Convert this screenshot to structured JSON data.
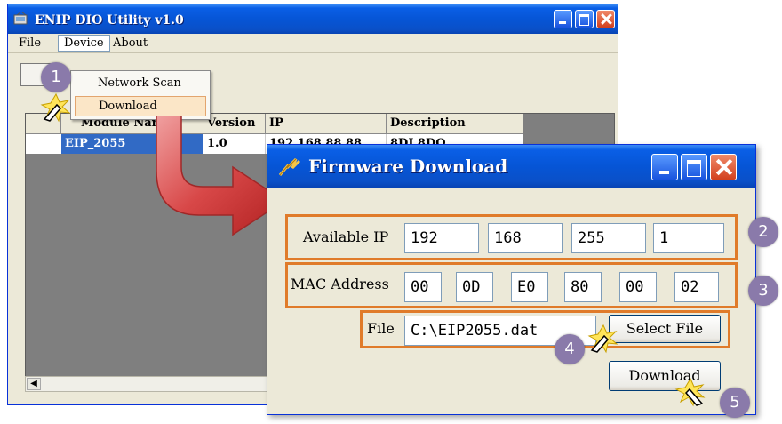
{
  "main_window": {
    "title": "ENIP DIO Utility  v1.0",
    "menu": {
      "file": "File",
      "device": "Device",
      "about": "About"
    },
    "dropdown": [
      "Network Scan",
      "Download"
    ],
    "grid": {
      "columns": [
        "Module Name",
        "Version",
        "IP",
        "Description"
      ],
      "rows": [
        {
          "index": "1",
          "module_name": "EIP_2055",
          "version": "1.0",
          "ip": "192.168.88.88",
          "description": "8DI 8DO"
        }
      ]
    }
  },
  "firmware_dialog": {
    "title": "Firmware Download",
    "available_ip_label": "Available IP",
    "ip_octets": [
      "192",
      "168",
      "255",
      "1"
    ],
    "mac_label": "MAC Address",
    "mac_bytes": [
      "00",
      "0D",
      "E0",
      "80",
      "00",
      "02"
    ],
    "file_label": "File",
    "file_path": "C:\\EIP2055.dat",
    "select_file_button": "Select File",
    "download_button": "Download"
  },
  "steps": [
    "1",
    "2",
    "3",
    "4",
    "5"
  ],
  "colors": {
    "xp_blue": "#0a5fe6",
    "highlight_orange": "#e07b2a",
    "badge": "#8a7aaa",
    "arrow_red": "#c93a3a"
  },
  "icons": [
    "app-icon",
    "minimize-icon",
    "maximize-icon",
    "close-icon",
    "hand-cursor-icon",
    "flow-arrow-icon",
    "firmware-icon"
  ]
}
